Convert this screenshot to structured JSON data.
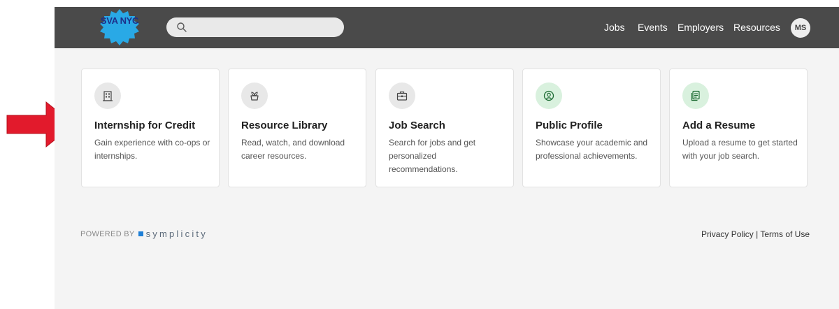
{
  "header": {
    "logo_text": "SVA NYC",
    "search": {
      "placeholder": "",
      "value": ""
    },
    "nav": [
      "Jobs",
      "Events",
      "Employers",
      "Resources"
    ],
    "avatar_initials": "MS"
  },
  "cards": [
    {
      "title": "Internship for Credit",
      "description": "Gain experience with co-ops or internships.",
      "icon": "building-icon",
      "icon_bg": "gray"
    },
    {
      "title": "Resource Library",
      "description": "Read, watch, and download career resources.",
      "icon": "plant-icon",
      "icon_bg": "gray"
    },
    {
      "title": "Job Search",
      "description": "Search for jobs and get personalized recommendations.",
      "icon": "briefcase-icon",
      "icon_bg": "gray"
    },
    {
      "title": "Public Profile",
      "description": "Showcase your academic and professional achievements.",
      "icon": "profile-icon",
      "icon_bg": "green"
    },
    {
      "title": "Add a Resume",
      "description": "Upload a resume to get started with your job search.",
      "icon": "document-icon",
      "icon_bg": "green"
    }
  ],
  "footer": {
    "powered_by": "POWERED BY",
    "brand": "symplicity",
    "privacy": "Privacy Policy",
    "separator": "|",
    "terms": "Terms of Use"
  },
  "colors": {
    "topbar": "#4a4a4a",
    "logo_blue": "#29a9e6",
    "green_icon": "#d9f1de",
    "arrow_red": "#e21a2c"
  }
}
